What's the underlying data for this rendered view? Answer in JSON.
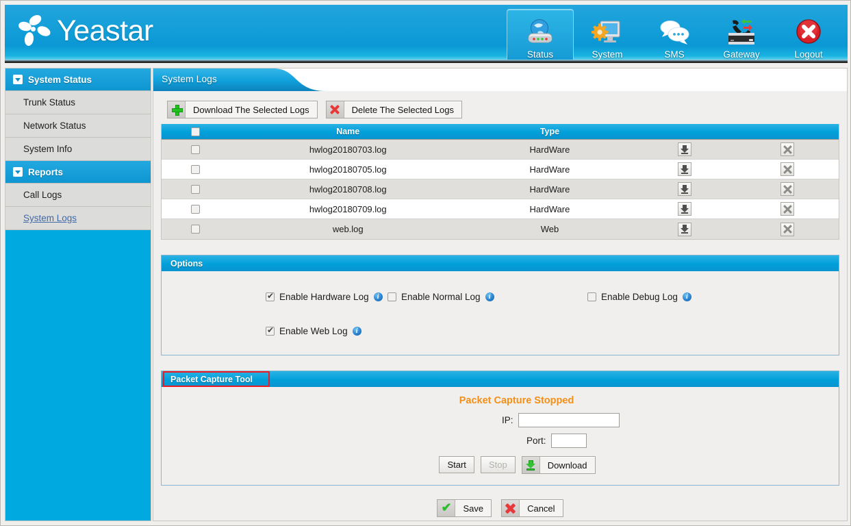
{
  "brand": {
    "name": "Yeastar",
    "logo_icon": "yeastar-flower-logo"
  },
  "topnav": [
    {
      "label": "Status",
      "icon": "globe-device-icon",
      "active": true
    },
    {
      "label": "System",
      "icon": "monitor-gear-icon",
      "active": false
    },
    {
      "label": "SMS",
      "icon": "speech-bubbles-icon",
      "active": false
    },
    {
      "label": "Gateway",
      "icon": "phone-gateway-icon",
      "active": false
    },
    {
      "label": "Logout",
      "icon": "red-x-circle-icon",
      "active": false
    }
  ],
  "sidebar": {
    "groups": [
      {
        "label": "System Status",
        "icon": "caret-down-icon",
        "items": [
          {
            "label": "Trunk Status",
            "current": false
          },
          {
            "label": "Network Status",
            "current": false
          },
          {
            "label": "System Info",
            "current": false
          }
        ]
      },
      {
        "label": "Reports",
        "icon": "caret-down-icon",
        "items": [
          {
            "label": "Call Logs",
            "current": false
          },
          {
            "label": "System Logs",
            "current": true
          }
        ]
      }
    ]
  },
  "tab": {
    "title": "System Logs"
  },
  "toolbar": {
    "download_selected": "Download The Selected Logs",
    "download_icon": "green-plus-icon",
    "delete_selected": "Delete The Selected Logs",
    "delete_icon": "red-x-icon"
  },
  "table": {
    "headers": {
      "name": "Name",
      "type": "Type"
    },
    "select_all_checked": false,
    "rows": [
      {
        "name": "hwlog20180703.log",
        "type": "HardWare",
        "checked": false,
        "download_icon": "download-icon",
        "delete_icon": "delete-x-icon"
      },
      {
        "name": "hwlog20180705.log",
        "type": "HardWare",
        "checked": false,
        "download_icon": "download-icon",
        "delete_icon": "delete-x-icon"
      },
      {
        "name": "hwlog20180708.log",
        "type": "HardWare",
        "checked": false,
        "download_icon": "download-icon",
        "delete_icon": "delete-x-icon"
      },
      {
        "name": "hwlog20180709.log",
        "type": "HardWare",
        "checked": false,
        "download_icon": "download-icon",
        "delete_icon": "delete-x-icon"
      },
      {
        "name": "web.log",
        "type": "Web",
        "checked": false,
        "download_icon": "download-icon",
        "delete_icon": "delete-x-icon"
      }
    ]
  },
  "options": {
    "title": "Options",
    "items": [
      {
        "label": "Enable Hardware Log",
        "checked": true,
        "info_icon": "info-icon"
      },
      {
        "label": "Enable Normal Log",
        "checked": false,
        "info_icon": "info-icon"
      },
      {
        "label": "Enable Debug Log",
        "checked": false,
        "info_icon": "info-icon"
      },
      {
        "label": "Enable Web Log",
        "checked": true,
        "info_icon": "info-icon"
      }
    ]
  },
  "packet_capture": {
    "title": "Packet Capture Tool",
    "highlighted": true,
    "highlight_color": "#ee1c22",
    "status": "Packet Capture Stopped",
    "status_color": "#f28f16",
    "ip_label": "IP:",
    "ip_value": "",
    "port_label": "Port:",
    "port_value": "",
    "start_label": "Start",
    "stop_label": "Stop",
    "stop_disabled": true,
    "download_label": "Download",
    "download_icon": "green-download-icon"
  },
  "footer": {
    "save_label": "Save",
    "save_icon": "green-check-icon",
    "cancel_label": "Cancel",
    "cancel_icon": "red-x-icon"
  },
  "colors": {
    "brand_blue": "#00a0da",
    "banner_blue": "#129ed8",
    "panel_bg": "#f0efed",
    "highlight_red": "#ee1c22",
    "status_orange": "#f28f16",
    "link_blue": "#4169a8"
  }
}
